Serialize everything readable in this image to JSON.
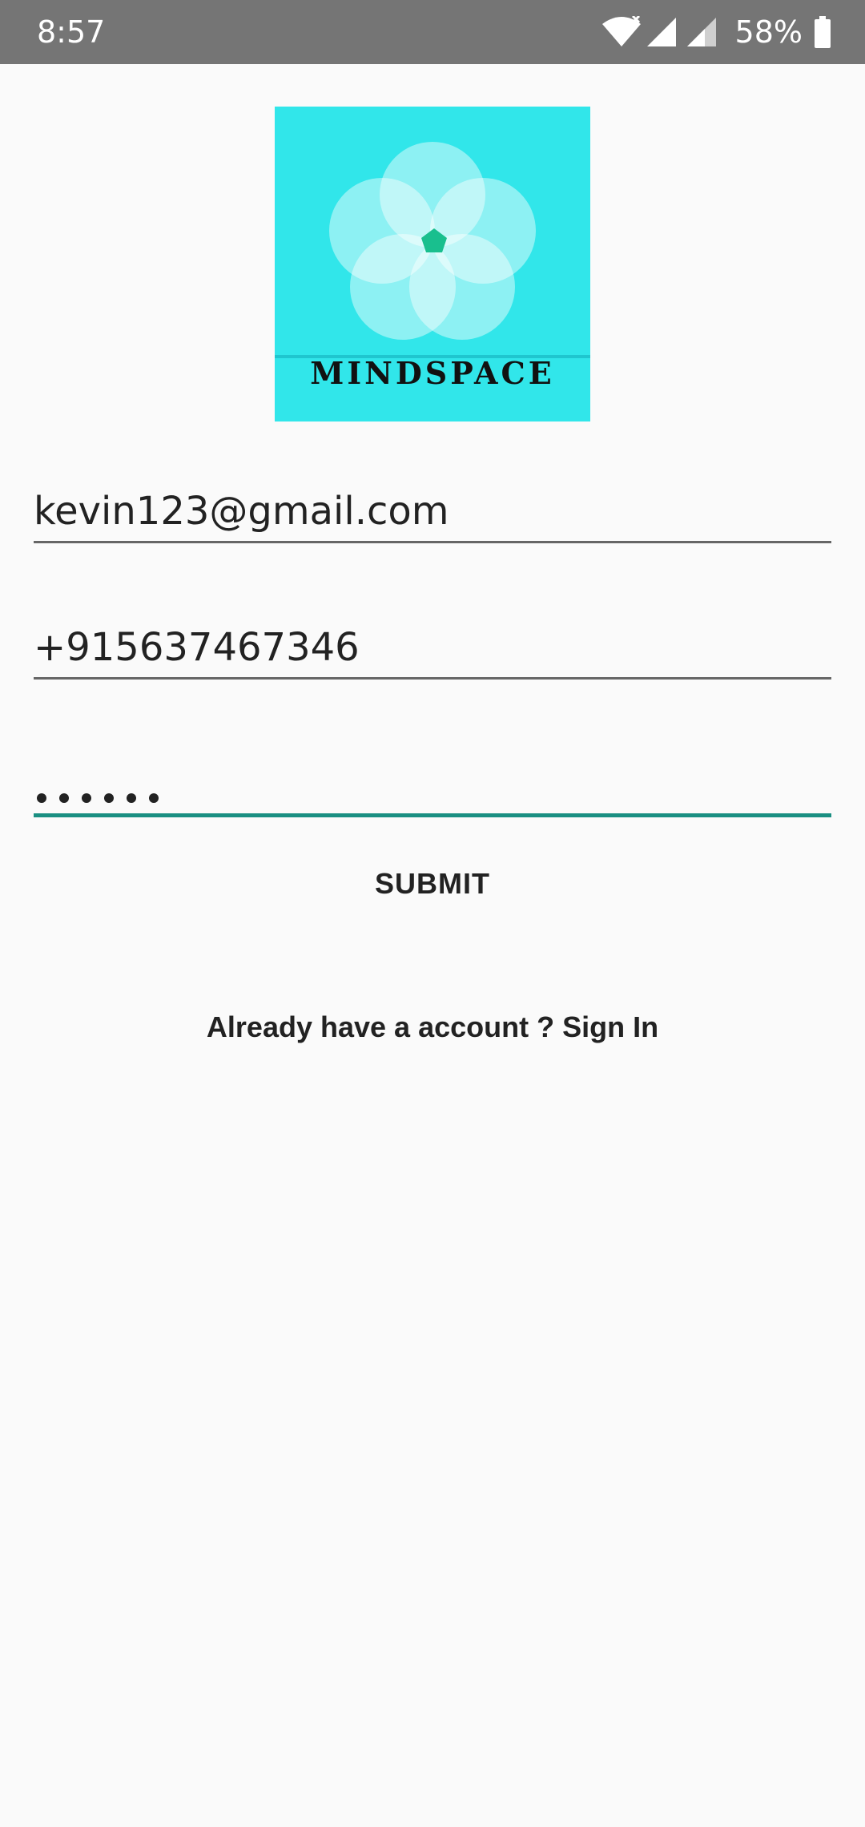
{
  "status_bar": {
    "time": "8:57",
    "battery_percent": "58%",
    "icons": [
      "wifi-icon",
      "signal-icon",
      "signal-icon",
      "battery-icon"
    ]
  },
  "logo": {
    "text": "MINDSPACE",
    "background_color": "#31e6ea",
    "accent_color": "#19bf8e"
  },
  "form": {
    "email_value": "kevin123@gmail.com",
    "phone_value": "+915637467346",
    "password_masked": "••••••",
    "accent_color": "#1a8f82"
  },
  "actions": {
    "submit_label": "SUBMIT",
    "signin_text": "Already have a account ? Sign In"
  }
}
